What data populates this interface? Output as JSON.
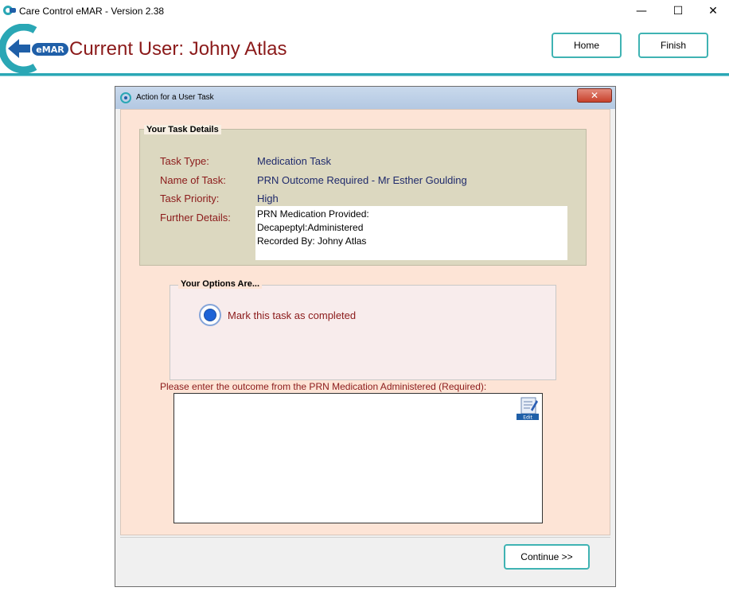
{
  "window": {
    "title": "Care Control eMAR - Version 2.38",
    "minimize": "—",
    "maximize": "☐",
    "close": "✕"
  },
  "header": {
    "logo_text": "eMAR",
    "current_user": "Current User: Johny Atlas",
    "home_label": "Home",
    "finish_label": "Finish"
  },
  "dialog": {
    "title": "Action for a User Task",
    "close_label": "✕",
    "task_details": {
      "legend": "Your Task Details",
      "task_type_label": "Task Type:",
      "task_type_value": "Medication Task",
      "name_label": "Name of Task:",
      "name_value": "PRN Outcome Required - Mr Esther Goulding",
      "priority_label": "Task Priority:",
      "priority_value": "High",
      "further_label": "Further Details:",
      "further_lines": [
        "PRN Medication Provided:",
        "Decapeptyl:Administered",
        "Recorded By: Johny Atlas"
      ]
    },
    "options": {
      "legend": "Your Options Are...",
      "radio_label": "Mark this task as completed",
      "selected": true
    },
    "outcome": {
      "label": "Please enter the outcome from the PRN Medication Administered (Required):",
      "value": "",
      "edit_icon_text": "Edit"
    },
    "continue_label": "Continue >>"
  },
  "colors": {
    "accent_teal": "#3fb3b3",
    "label_red": "#8b1a1a",
    "value_blue": "#1f2a6b",
    "dialog_body": "#fde4d6",
    "task_box": "#dcd8c0"
  }
}
